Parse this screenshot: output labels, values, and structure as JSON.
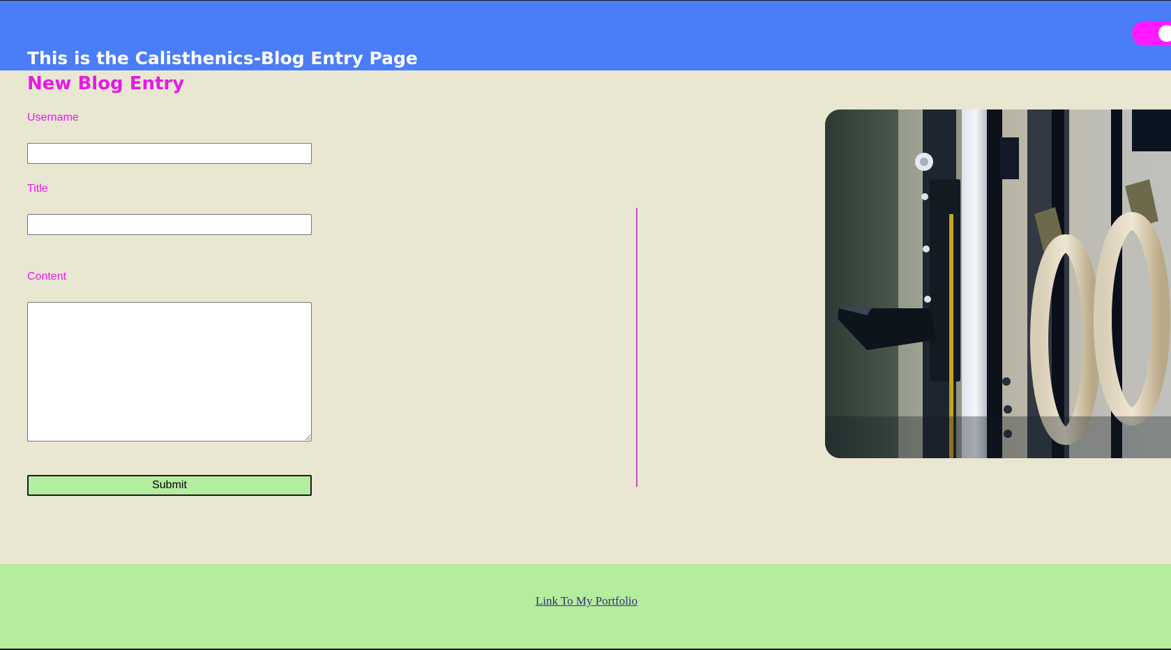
{
  "header": {
    "title": "This is the Calisthenics-Blog Entry Page",
    "theme_toggle": {
      "state": "on",
      "color": "#ff1aff"
    }
  },
  "form": {
    "heading": "New Blog Entry",
    "fields": {
      "username": {
        "label": "Username",
        "value": ""
      },
      "title": {
        "label": "Title",
        "value": ""
      },
      "content": {
        "label": "Content",
        "value": ""
      }
    },
    "submit_label": "Submit"
  },
  "photo": {
    "subject": "gymnastic rings hanging from a wall-mounted rack"
  },
  "footer": {
    "link_text": "Link To My Portfolio"
  },
  "colors": {
    "header_bg": "#4a7df8",
    "page_bg": "#e9e7d1",
    "accent": "#e51ae5",
    "footer_bg": "#b4ed9d",
    "button_bg": "#b4ed9d"
  }
}
